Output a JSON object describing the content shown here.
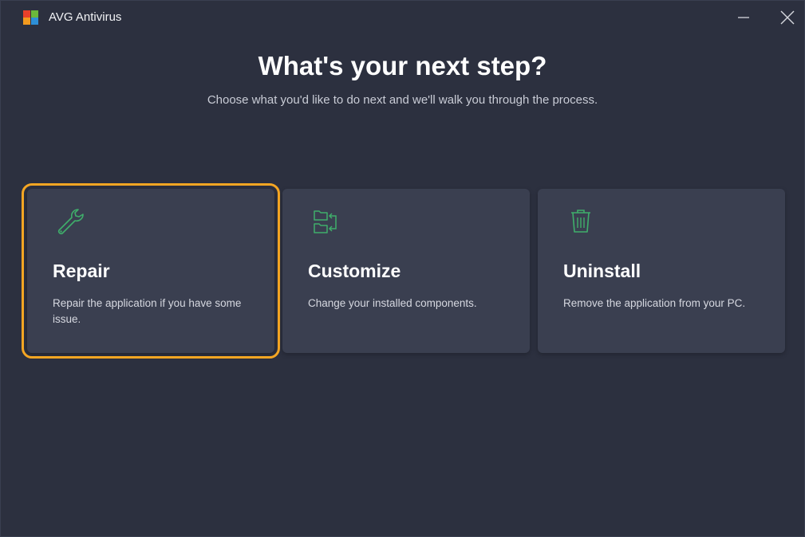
{
  "window": {
    "title": "AVG Antivirus",
    "minimize_icon": "minimize-icon",
    "close_icon": "close-icon"
  },
  "main": {
    "heading": "What's your next step?",
    "subheading": "Choose what you'd like to do next and we'll walk you through the process."
  },
  "options": [
    {
      "icon": "wrench-icon",
      "title": "Repair",
      "description": "Repair the application if you have some issue.",
      "selected": true
    },
    {
      "icon": "folders-icon",
      "title": "Customize",
      "description": "Change your installed components.",
      "selected": false
    },
    {
      "icon": "trash-icon",
      "title": "Uninstall",
      "description": "Remove the application from your PC.",
      "selected": false
    }
  ],
  "colors": {
    "background": "#2c303f",
    "card": "#3a3f50",
    "selection": "#f5a623",
    "icon_green": "#3fae6b"
  }
}
